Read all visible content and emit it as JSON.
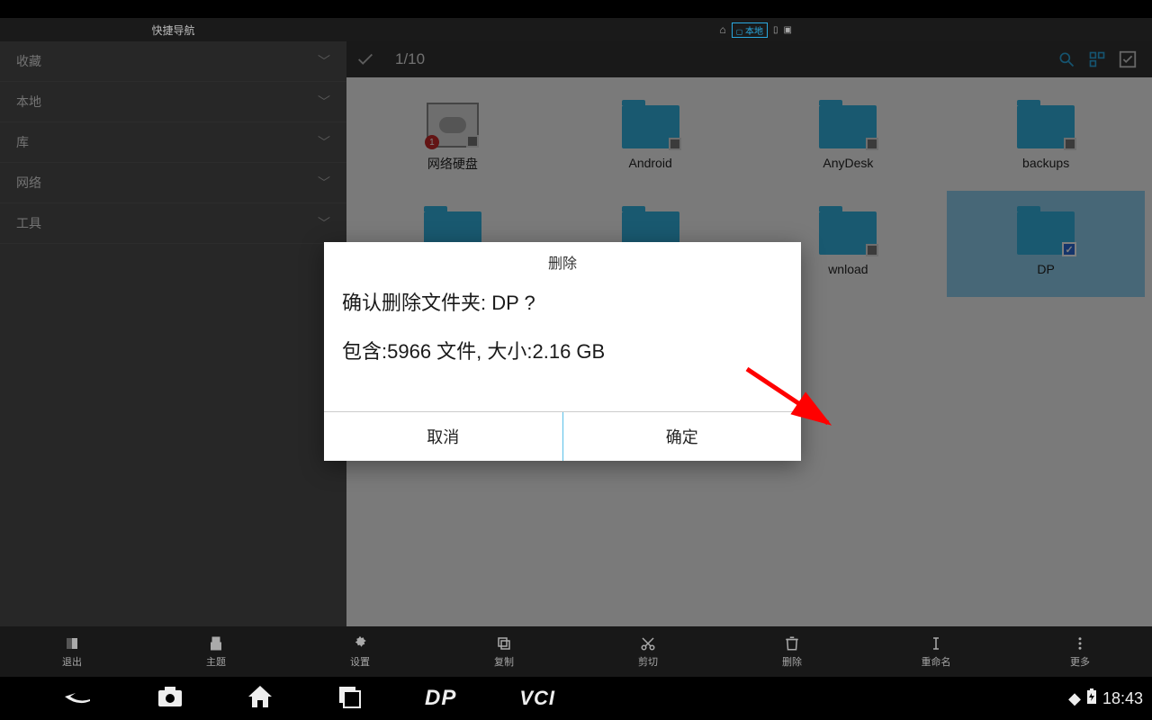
{
  "header": {
    "quick_nav": "快捷导航",
    "location_tag": "本地"
  },
  "sidebar": {
    "items": [
      {
        "label": "收藏"
      },
      {
        "label": "本地"
      },
      {
        "label": "库"
      },
      {
        "label": "网络"
      },
      {
        "label": "工具"
      }
    ]
  },
  "content": {
    "counter": "1/10",
    "folders": [
      {
        "label": "网络硬盘",
        "type": "net",
        "badge": "1"
      },
      {
        "label": "Android",
        "type": "folder"
      },
      {
        "label": "AnyDesk",
        "type": "folder"
      },
      {
        "label": "backups",
        "type": "folder"
      },
      {
        "label": "",
        "type": "folder_partial"
      },
      {
        "label": "",
        "type": "folder_partial"
      },
      {
        "label": "wnload",
        "type": "folder_partial_label"
      },
      {
        "label": "DP",
        "type": "folder",
        "selected": true
      }
    ]
  },
  "dialog": {
    "title": "删除",
    "line1": "确认删除文件夹: DP ?",
    "line2": "包含:5966 文件, 大小:2.16 GB",
    "cancel": "取消",
    "confirm": "确定"
  },
  "toolbar": {
    "items": [
      {
        "label": "退出"
      },
      {
        "label": "主题"
      },
      {
        "label": "设置"
      },
      {
        "label": "复制"
      },
      {
        "label": "剪切"
      },
      {
        "label": "删除"
      },
      {
        "label": "重命名"
      },
      {
        "label": "更多"
      }
    ]
  },
  "nav": {
    "dp": "DP",
    "vci": "VCI",
    "time": "18:43"
  }
}
